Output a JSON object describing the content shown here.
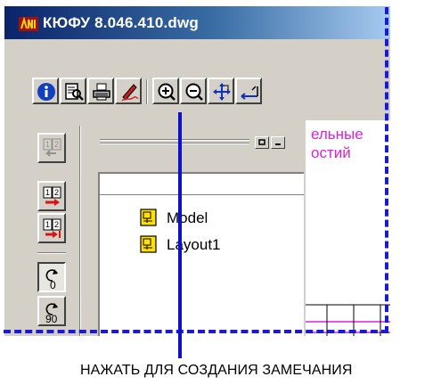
{
  "window": {
    "title": "КЮФУ 8.046.410.dwg"
  },
  "toolbar": {
    "buttons": [
      {
        "icon": "info-icon"
      },
      {
        "icon": "print-preview-icon"
      },
      {
        "icon": "print-icon"
      },
      {
        "icon": "redline-pen-icon"
      },
      {
        "icon": "zoom-in-icon"
      },
      {
        "icon": "zoom-out-icon"
      },
      {
        "icon": "pan-icon"
      },
      {
        "icon": "measure-icon"
      }
    ]
  },
  "left_toolbar": {
    "buttons": [
      {
        "icon": "page-nav-disabled-icon"
      },
      {
        "icon": "page-next-icon"
      },
      {
        "icon": "page-last-icon"
      },
      {
        "icon": "rotate-0-icon",
        "label": "0"
      },
      {
        "icon": "rotate-90-icon",
        "label": "90"
      }
    ]
  },
  "tree": {
    "items": [
      {
        "label": "Model"
      },
      {
        "label": "Layout1"
      }
    ]
  },
  "drawing": {
    "text_lines": [
      "ельные",
      "остий"
    ],
    "line_color": "#e020e0"
  },
  "annotation": {
    "caption": "НАЖАТЬ ДЛЯ СОЗДАНИЯ ЗАМЕЧАНИЯ",
    "frame_color": "#1a1ad0"
  }
}
